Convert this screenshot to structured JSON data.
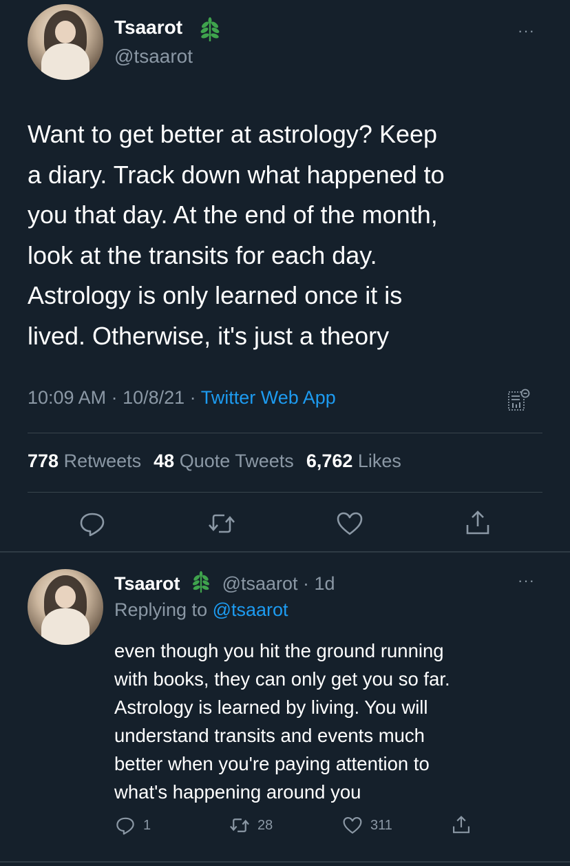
{
  "main_tweet": {
    "name": "Tsaarot",
    "handle": "@tsaarot",
    "more_label": "···",
    "text": "Want to get better at astrology? Keep\na diary. Track down what happened to\nyou that day. At the end of the month,\nlook at the transits for each day.\nAstrology is only learned once it is\nlived. Otherwise, it's just a theory",
    "time": "10:09 AM",
    "dot": " · ",
    "date": "10/8/21",
    "source": "Twitter Web App",
    "stats": {
      "retweets_count": "778",
      "retweets_label": "Retweets",
      "quotes_count": "48",
      "quotes_label": "Quote Tweets",
      "likes_count": "6,762",
      "likes_label": "Likes"
    }
  },
  "reply_tweet": {
    "name": "Tsaarot",
    "handle_time": "@tsaarot · 1d",
    "more_label": "···",
    "replying_prefix": "Replying to ",
    "replying_handle": "@tsaarot",
    "text": "even though you hit the ground running\nwith books, they can only get you so far.\nAstrology is learned by living. You will\nunderstand transits and events much\nbetter when you're paying attention to\nwhat's happening around you",
    "reply_count": "1",
    "retweet_count": "28",
    "like_count": "311"
  },
  "colors": {
    "background": "#15202b",
    "text": "#ffffff",
    "secondary": "#8b98a5",
    "link": "#1d9bf0",
    "verified_leaf": "#3fa34d"
  },
  "icons": [
    "more-icon",
    "verified-leaf-icon",
    "analytics-icon",
    "reply-icon",
    "retweet-icon",
    "like-icon",
    "share-icon"
  ]
}
